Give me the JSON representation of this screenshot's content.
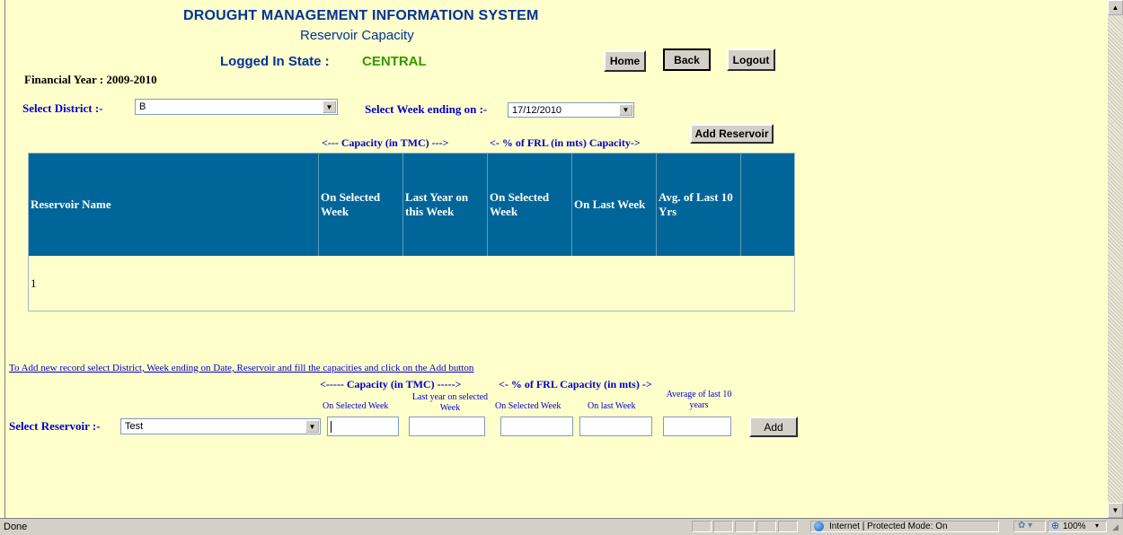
{
  "header": {
    "system_title": "DROUGHT MANAGEMENT INFORMATION SYSTEM",
    "page_subtitle": "Reservoir Capacity",
    "logged_in_label": "Logged In State :",
    "logged_in_state": "CENTRAL",
    "financial_year": "Financial Year : 2009-2010"
  },
  "nav": {
    "home": "Home",
    "back": "Back",
    "logout": "Logout"
  },
  "filters": {
    "district_label": "Select District :-",
    "district_value": "B",
    "week_label": "Select Week ending on :-",
    "week_value": "17/12/2010"
  },
  "add_reservoir_button": "Add Reservoir",
  "capacity_caption": {
    "tmc": "<--- Capacity (in TMC) --->",
    "frl": "<- % of FRL (in mts) Capacity->"
  },
  "table": {
    "headers": [
      "Reservoir Name",
      "On Selected Week",
      "Last Year on this Week",
      "On Selected Week",
      "On Last Week",
      "Avg. of Last 10 Yrs",
      ""
    ],
    "rows": [
      [
        "1",
        "",
        "",
        "",
        "",
        "",
        ""
      ]
    ]
  },
  "add_form": {
    "instruction_link": "To Add new record select District, Week ending on Date, Reservoir and fill the capacities and click on the Add button",
    "caption_tmc": "<----- Capacity (in TMC) ----->",
    "caption_frl": "<- % of FRL Capacity (in mts) ->",
    "col_on_selected_week": "On Selected Week",
    "col_last_year": "Last year on selected Week",
    "col_on_selected_week_2": "On Selected Week",
    "col_on_last_week": "On last Week",
    "col_average": "Average of last 10 years",
    "reservoir_label": "Select Reservoir :-",
    "reservoir_value": "Test",
    "add_button": "Add"
  },
  "statusbar": {
    "left": "Done",
    "zone": "Internet | Protected Mode: On",
    "zoom": "100%"
  },
  "colors": {
    "page_bg": "#ffffcc",
    "table_header_bg": "#006699",
    "title_blue": "#003399",
    "state_green": "#339900"
  }
}
